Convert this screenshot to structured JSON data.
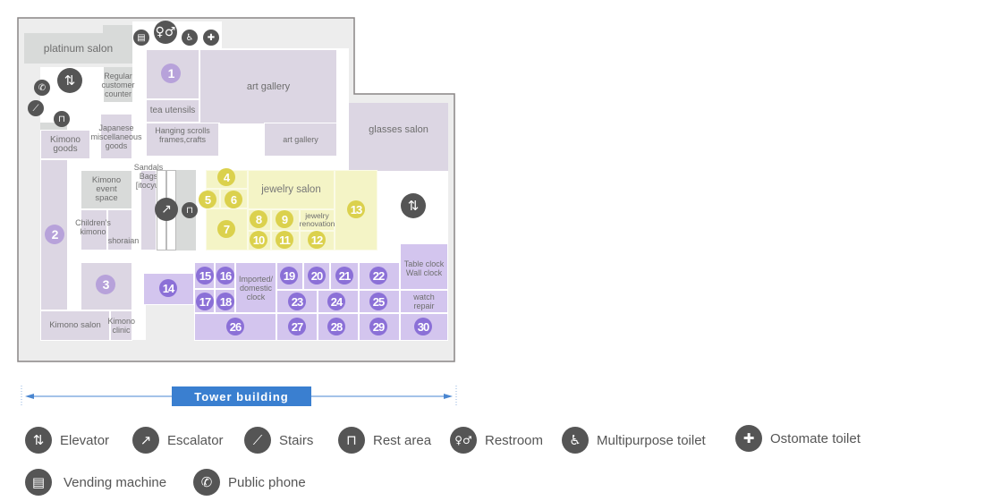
{
  "rooms": {
    "platinum_salon": "platinum salon",
    "regular_customer_counter": "Regular customer counter",
    "art_gallery_main": "art gallery",
    "art_gallery_small": "art gallery",
    "tea_utensils": "tea utensils",
    "hanging_scrolls": "Hanging scrolls frames,crafts",
    "glasses_salon": "glasses salon",
    "kimono_goods": "Kimono goods",
    "japanese_misc": "Japanese miscellaneous goods",
    "kimono_event_space": "Kimono event space",
    "childrens_kimono": "Children's kimono",
    "shoraian": "shoraian",
    "sandals_bags": "Sandals Bags [itocyu]",
    "kimono_salon": "Kimono salon",
    "kimono_clinic": "Kimono clinic",
    "jewelry_salon": "jewelry salon",
    "jewelry_renovation": "jewelry renovation",
    "imported_domestic_clock": "Imported/ domestic clock",
    "table_wall_clock": "Table clock Wall clock",
    "watch_repair": "watch repair"
  },
  "numbered_areas": [
    "1",
    "2",
    "3",
    "4",
    "5",
    "6",
    "7",
    "8",
    "9",
    "10",
    "11",
    "12",
    "13",
    "14",
    "15",
    "16",
    "17",
    "18",
    "19",
    "20",
    "21",
    "22",
    "23",
    "24",
    "25",
    "26",
    "27",
    "28",
    "29",
    "30"
  ],
  "colors": {
    "gray_room": "#d8dad9",
    "lavender_room": "#dcd6e3",
    "purple_room": "#d3c5ee",
    "yellow_room": "#f4f4c6",
    "purple_marker": "#8b70d7",
    "light_purple_marker": "#b7a2da",
    "yellow_marker": "#dbd14d",
    "icon": "#555555",
    "tower_label": "#3a7fd0"
  },
  "building": {
    "label": "Tower building"
  },
  "legend": [
    {
      "icon": "elevator-icon",
      "label": "Elevator"
    },
    {
      "icon": "escalator-icon",
      "label": "Escalator"
    },
    {
      "icon": "stairs-icon",
      "label": "Stairs"
    },
    {
      "icon": "rest-area-icon",
      "label": "Rest area"
    },
    {
      "icon": "restroom-icon",
      "label": "Restroom"
    },
    {
      "icon": "multipurpose-toilet-icon",
      "label": "Multipurpose toilet"
    },
    {
      "icon": "ostomate-toilet-icon",
      "label": "Ostomate toilet"
    },
    {
      "icon": "vending-machine-icon",
      "label": "Vending machine"
    },
    {
      "icon": "public-phone-icon",
      "label": "Public phone"
    }
  ]
}
